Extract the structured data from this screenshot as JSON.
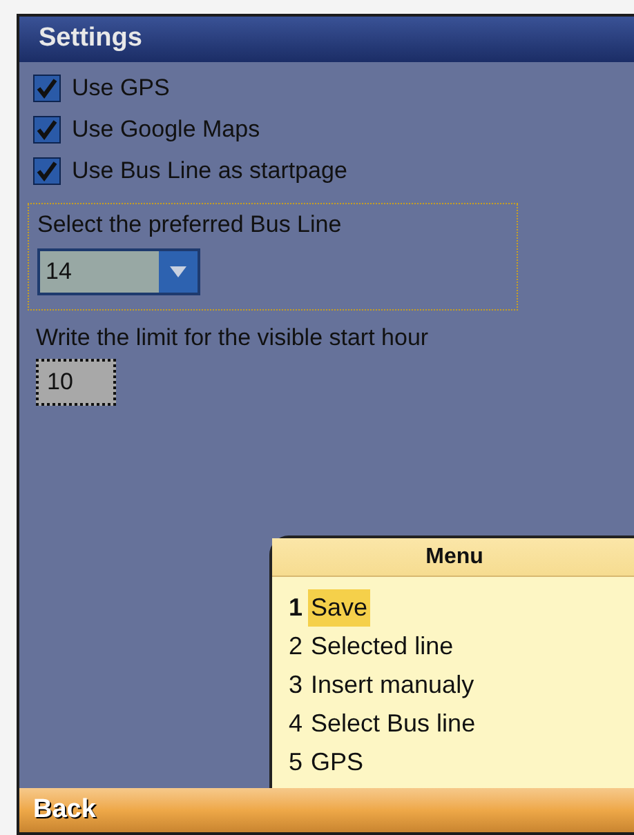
{
  "window": {
    "title": "Settings"
  },
  "options": [
    {
      "label": "Use GPS",
      "checked": true
    },
    {
      "label": "Use Google Maps",
      "checked": true
    },
    {
      "label": "Use Bus Line as startpage",
      "checked": true
    }
  ],
  "bus_line": {
    "label": "Select the preferred Bus Line",
    "value": "14"
  },
  "start_hour": {
    "label": "Write the limit for the visible start hour",
    "value": "10"
  },
  "menu": {
    "title": "Menu",
    "items": [
      {
        "number": "1",
        "label": "Save",
        "selected": true
      },
      {
        "number": "2",
        "label": "Selected line",
        "selected": false
      },
      {
        "number": "3",
        "label": "Insert manualy",
        "selected": false
      },
      {
        "number": "4",
        "label": "Select Bus line",
        "selected": false
      },
      {
        "number": "5",
        "label": "GPS",
        "selected": false
      }
    ]
  },
  "softkey": {
    "label": "Back"
  }
}
